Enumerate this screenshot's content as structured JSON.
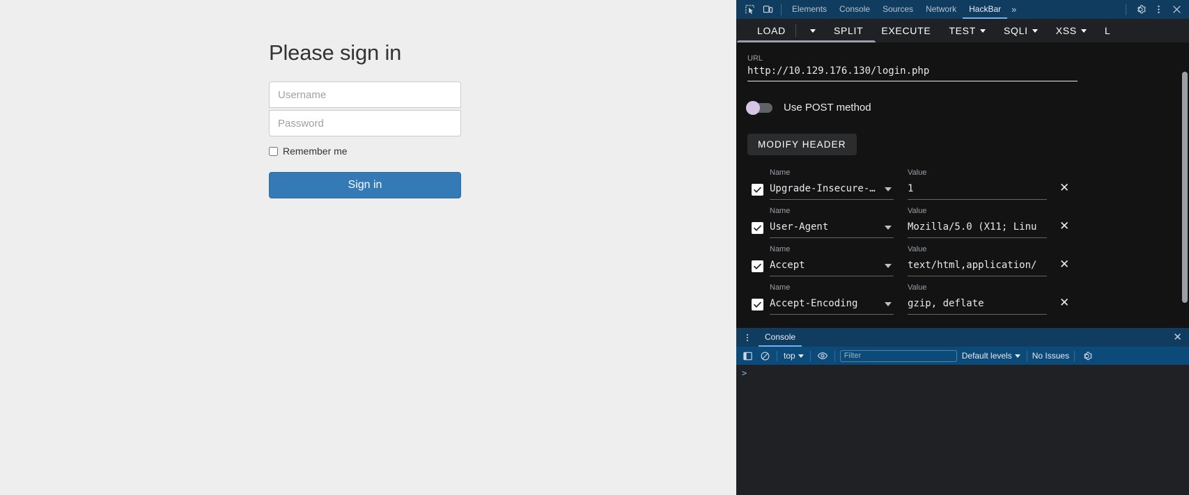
{
  "page": {
    "title": "Please sign in",
    "username_placeholder": "Username",
    "password_placeholder": "Password",
    "username_value": "",
    "password_value": "",
    "remember_label": "Remember me",
    "signin_label": "Sign in",
    "accent_color": "#337ab7",
    "background_color": "#eeeeee"
  },
  "devtools": {
    "tabs": [
      {
        "label": "Elements",
        "active": false
      },
      {
        "label": "Console",
        "active": false
      },
      {
        "label": "Sources",
        "active": false
      },
      {
        "label": "Network",
        "active": false
      },
      {
        "label": "HackBar",
        "active": true
      }
    ],
    "more_tabs_label": "»",
    "inspect_icon": "inspect-element-icon",
    "device_icon": "device-toolbar-icon",
    "settings_icon": "gear-icon",
    "menu_icon": "kebab-menu-icon",
    "close_icon": "close-icon",
    "tabbar_color": "#103c5f"
  },
  "hackbar": {
    "toolbar": [
      {
        "label": "LOAD",
        "has_caret": false
      },
      {
        "label": "",
        "has_caret": true
      },
      {
        "label": "SPLIT",
        "has_caret": false
      },
      {
        "label": "EXECUTE",
        "has_caret": false
      },
      {
        "label": "TEST",
        "has_caret": true
      },
      {
        "label": "SQLI",
        "has_caret": true
      },
      {
        "label": "XSS",
        "has_caret": true
      },
      {
        "label": "L",
        "has_caret": false
      }
    ],
    "url_label": "URL",
    "url_value": "http://10.129.176.130/login.php",
    "post_toggle_label": "Use POST method",
    "post_toggle_on": false,
    "modify_header_label": "MODIFY HEADER",
    "name_column_label": "Name",
    "value_column_label": "Value",
    "remove_icon": "close-icon",
    "headers": [
      {
        "enabled": true,
        "name": "Upgrade-Insecure-…",
        "value": "1"
      },
      {
        "enabled": true,
        "name": "User-Agent",
        "value": "Mozilla/5.0 (X11; Linu"
      },
      {
        "enabled": true,
        "name": "Accept",
        "value": "text/html,application/"
      },
      {
        "enabled": true,
        "name": "Accept-Encoding",
        "value": "gzip, deflate"
      }
    ]
  },
  "drawer": {
    "kebab_icon": "kebab-menu-icon",
    "tab_label": "Console",
    "close_icon": "close-icon",
    "console_toolbar": {
      "sidebar_icon": "console-sidebar-icon",
      "clear_icon": "clear-console-icon",
      "context_selector": "top",
      "eye_icon": "live-expression-icon",
      "filter_placeholder": "Filter",
      "filter_value": "",
      "levels_selector": "Default levels",
      "issues_label": "No Issues",
      "settings_icon": "gear-icon"
    },
    "prompt_symbol": ">"
  }
}
